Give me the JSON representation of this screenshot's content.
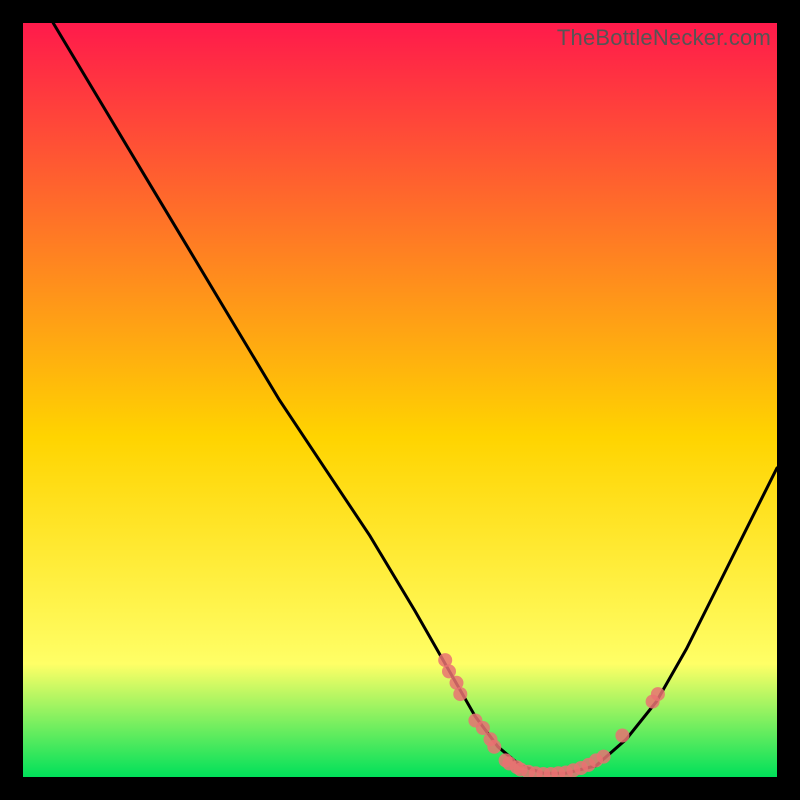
{
  "watermark": "TheBottleNecker.com",
  "colors": {
    "top": "#ff1a4b",
    "mid": "#ffd400",
    "lowmid": "#ffff66",
    "bottom": "#00e05a",
    "curve": "#000000",
    "marker": "#e97272"
  },
  "chart_data": {
    "type": "line",
    "title": "",
    "xlabel": "",
    "ylabel": "",
    "xlim": [
      0,
      100
    ],
    "ylim": [
      0,
      100
    ],
    "curve": {
      "x": [
        4,
        10,
        16,
        22,
        28,
        34,
        40,
        46,
        52,
        56,
        60,
        63,
        66,
        69,
        72,
        76,
        80,
        84,
        88,
        92,
        96,
        100
      ],
      "y": [
        100,
        90,
        80,
        70,
        60,
        50,
        41,
        32,
        22,
        15,
        8,
        4,
        1.5,
        0.5,
        0.5,
        1.5,
        5,
        10,
        17,
        25,
        33,
        41
      ]
    },
    "markers": [
      {
        "x": 56.0,
        "y": 15.5
      },
      {
        "x": 56.5,
        "y": 14.0
      },
      {
        "x": 57.5,
        "y": 12.5
      },
      {
        "x": 58.0,
        "y": 11.0
      },
      {
        "x": 60.0,
        "y": 7.5
      },
      {
        "x": 61.0,
        "y": 6.5
      },
      {
        "x": 62.0,
        "y": 5.0
      },
      {
        "x": 62.5,
        "y": 4.0
      },
      {
        "x": 64.0,
        "y": 2.2
      },
      {
        "x": 64.5,
        "y": 1.8
      },
      {
        "x": 65.5,
        "y": 1.3
      },
      {
        "x": 66.0,
        "y": 1.0
      },
      {
        "x": 67.0,
        "y": 0.7
      },
      {
        "x": 68.0,
        "y": 0.5
      },
      {
        "x": 69.0,
        "y": 0.4
      },
      {
        "x": 70.0,
        "y": 0.4
      },
      {
        "x": 71.0,
        "y": 0.5
      },
      {
        "x": 72.0,
        "y": 0.6
      },
      {
        "x": 73.0,
        "y": 0.9
      },
      {
        "x": 74.0,
        "y": 1.2
      },
      {
        "x": 75.0,
        "y": 1.6
      },
      {
        "x": 76.0,
        "y": 2.2
      },
      {
        "x": 77.0,
        "y": 2.7
      },
      {
        "x": 79.5,
        "y": 5.5
      },
      {
        "x": 83.5,
        "y": 10.0
      },
      {
        "x": 84.2,
        "y": 11.0
      }
    ]
  }
}
